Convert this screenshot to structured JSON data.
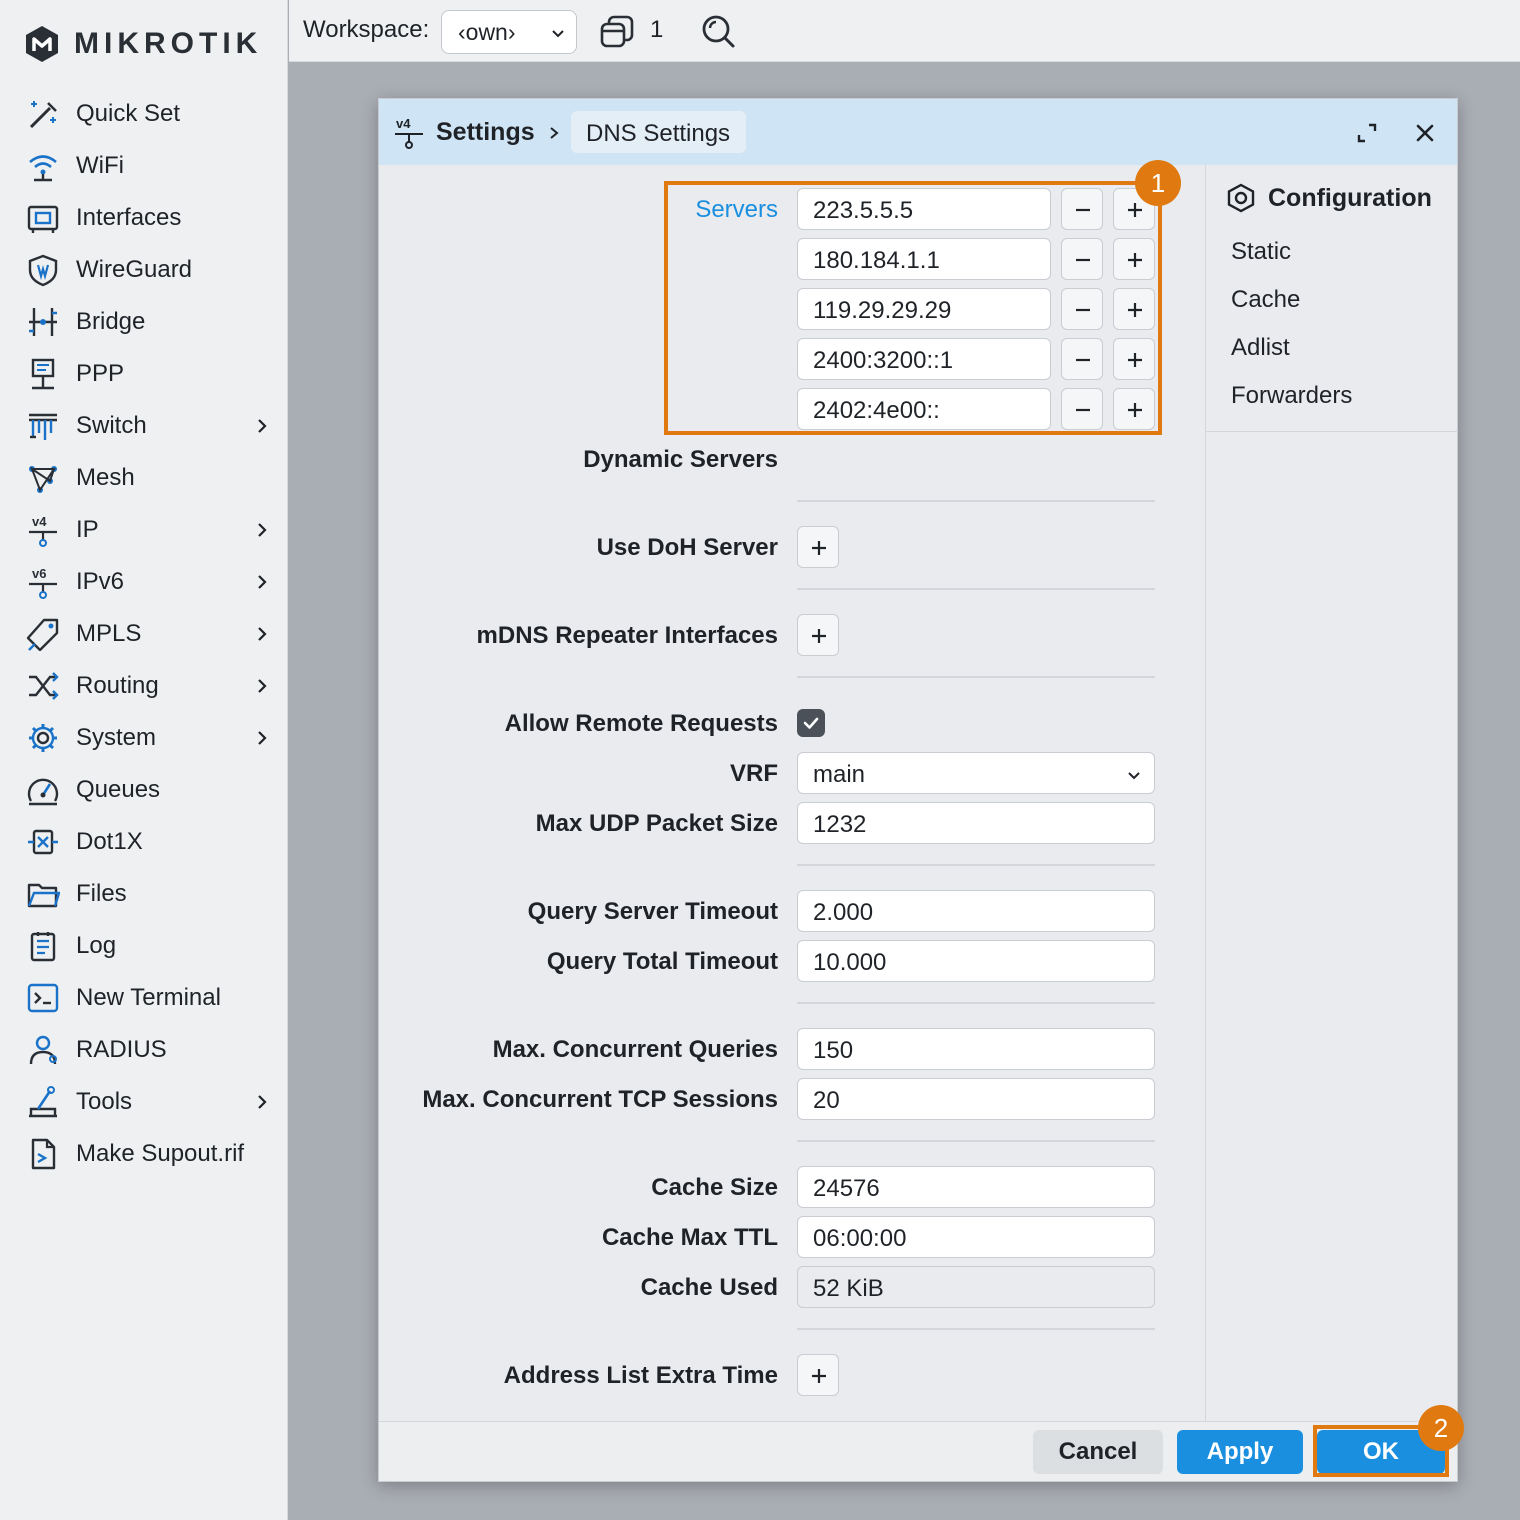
{
  "brand": "MIKROTIK",
  "sidebar": {
    "items": [
      {
        "label": "Quick Set",
        "icon": "magic-wand-icon",
        "chevron": false
      },
      {
        "label": "WiFi",
        "icon": "wifi-icon",
        "chevron": false
      },
      {
        "label": "Interfaces",
        "icon": "ethernet-port-icon",
        "chevron": false
      },
      {
        "label": "WireGuard",
        "icon": "shield-icon",
        "chevron": false
      },
      {
        "label": "Bridge",
        "icon": "bridge-icon",
        "chevron": false
      },
      {
        "label": "PPP",
        "icon": "ppp-computer-icon",
        "chevron": false
      },
      {
        "label": "Switch",
        "icon": "switch-icon",
        "chevron": true
      },
      {
        "label": "Mesh",
        "icon": "mesh-icon",
        "chevron": false
      },
      {
        "label": "IP",
        "icon": "ipv4-icon",
        "chevron": true
      },
      {
        "label": "IPv6",
        "icon": "ipv6-icon",
        "chevron": true
      },
      {
        "label": "MPLS",
        "icon": "tag-icon",
        "chevron": true
      },
      {
        "label": "Routing",
        "icon": "routing-arrows-icon",
        "chevron": true
      },
      {
        "label": "System",
        "icon": "gear-icon",
        "chevron": true
      },
      {
        "label": "Queues",
        "icon": "gauge-icon",
        "chevron": false
      },
      {
        "label": "Dot1X",
        "icon": "dot1x-icon",
        "chevron": false
      },
      {
        "label": "Files",
        "icon": "folder-icon",
        "chevron": false
      },
      {
        "label": "Log",
        "icon": "log-icon",
        "chevron": false
      },
      {
        "label": "New Terminal",
        "icon": "terminal-icon",
        "chevron": false
      },
      {
        "label": "RADIUS",
        "icon": "radius-user-icon",
        "chevron": false
      },
      {
        "label": "Tools",
        "icon": "tools-icon",
        "chevron": true
      },
      {
        "label": "Make Supout.rif",
        "icon": "file-export-icon",
        "chevron": false
      }
    ]
  },
  "topbar": {
    "workspace_label": "Workspace:",
    "workspace_value": "‹own›",
    "window_count": "1"
  },
  "dialog": {
    "breadcrumb_root": "Settings",
    "breadcrumb_current": "DNS Settings",
    "right_panel": {
      "title": "Configuration",
      "items": [
        "Static",
        "Cache",
        "Adlist",
        "Forwarders"
      ]
    },
    "fields": {
      "servers_label": "Servers",
      "servers": [
        "223.5.5.5",
        "180.184.1.1",
        "119.29.29.29",
        "2400:3200::1",
        "2402:4e00::"
      ],
      "dynamic_servers_label": "Dynamic Servers",
      "use_doh_label": "Use DoH Server",
      "mdns_label": "mDNS Repeater Interfaces",
      "allow_remote_label": "Allow Remote Requests",
      "allow_remote_checked": true,
      "vrf_label": "VRF",
      "vrf_value": "main",
      "max_udp_label": "Max UDP Packet Size",
      "max_udp_value": "1232",
      "query_server_timeout_label": "Query Server Timeout",
      "query_server_timeout_value": "2.000",
      "query_total_timeout_label": "Query Total Timeout",
      "query_total_timeout_value": "10.000",
      "max_concurrent_queries_label": "Max. Concurrent Queries",
      "max_concurrent_queries_value": "150",
      "max_tcp_sessions_label": "Max. Concurrent TCP Sessions",
      "max_tcp_sessions_value": "20",
      "cache_size_label": "Cache Size",
      "cache_size_value": "24576",
      "cache_max_ttl_label": "Cache Max TTL",
      "cache_max_ttl_value": "06:00:00",
      "cache_used_label": "Cache Used",
      "cache_used_value": "52 KiB",
      "address_list_extra_label": "Address List Extra Time"
    },
    "footer": {
      "cancel": "Cancel",
      "apply": "Apply",
      "ok": "OK"
    }
  },
  "annotations": {
    "badge_1": "1",
    "badge_2": "2",
    "highlight_color": "#e07a10"
  },
  "colors": {
    "accent": "#1a8fe0",
    "icon_blue": "#1a73c8",
    "header_bg": "#cfe4f4"
  }
}
